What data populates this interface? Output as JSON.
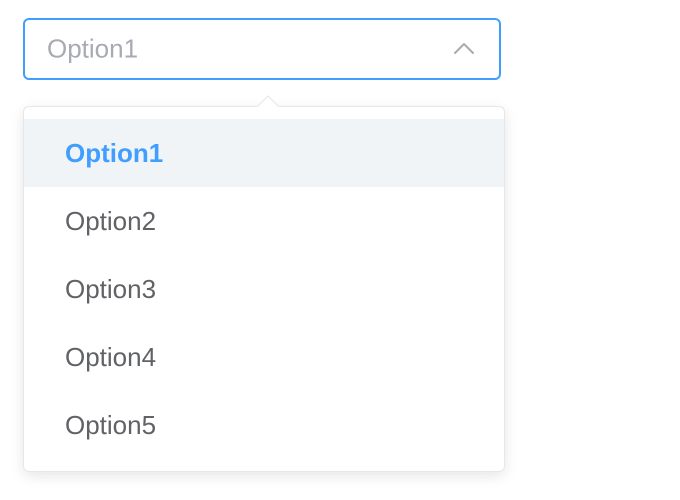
{
  "select": {
    "placeholder": "Option1",
    "arrow_icon": "chevron-up-icon",
    "expanded": true
  },
  "dropdown": {
    "selected_index": 0,
    "options": [
      {
        "label": "Option1"
      },
      {
        "label": "Option2"
      },
      {
        "label": "Option3"
      },
      {
        "label": "Option4"
      },
      {
        "label": "Option5"
      }
    ]
  },
  "colors": {
    "accent": "#409eff",
    "selected_bg": "#f1f4f7",
    "option_text": "#606266",
    "placeholder_text": "#a8abb2",
    "border": "#e4e7ed"
  }
}
